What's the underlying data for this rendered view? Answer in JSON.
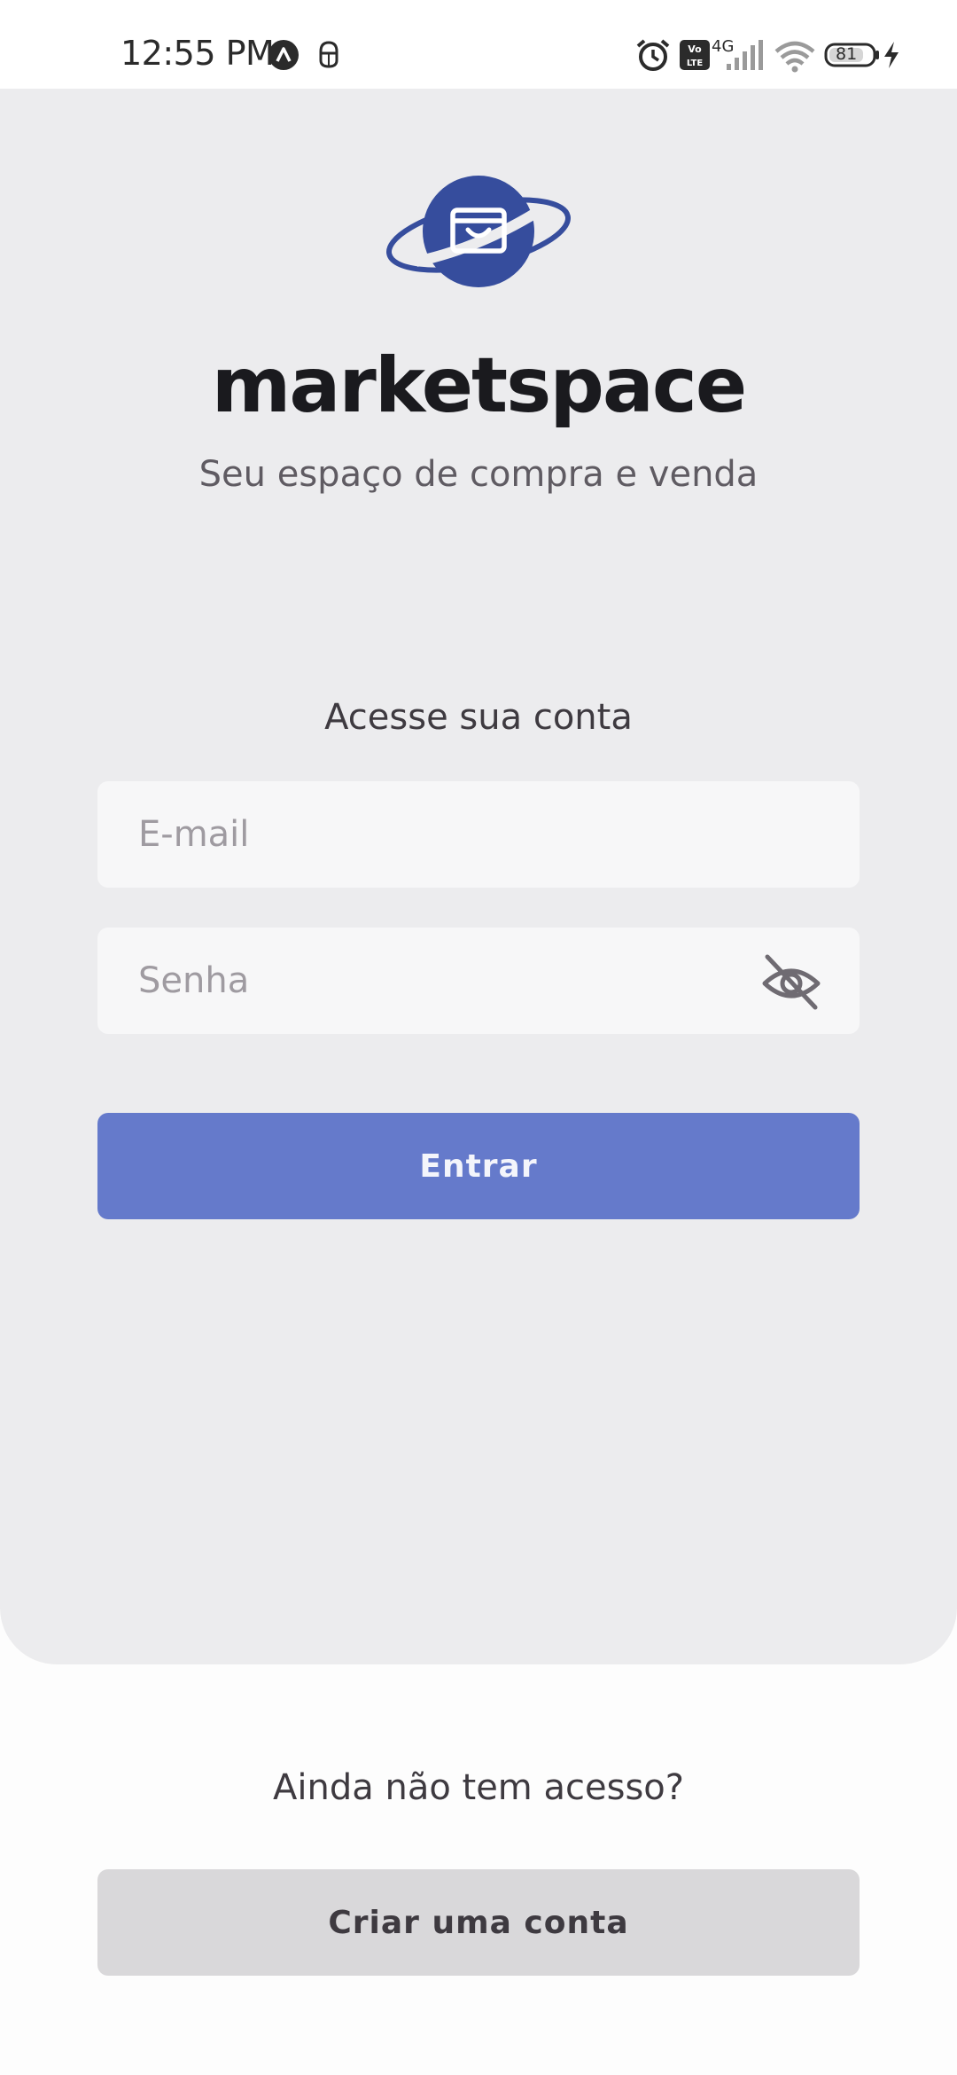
{
  "status_bar": {
    "time": "12:55 PM",
    "network": "4G",
    "volte": "Vo LTE",
    "battery_level": "81",
    "icons": [
      "app-notification-icon",
      "android-debug-icon",
      "alarm-icon",
      "volte-icon",
      "signal-icon",
      "wifi-icon",
      "battery-icon",
      "charging-icon"
    ]
  },
  "brand": {
    "name": "marketspace",
    "tagline": "Seu espaço de compra e venda",
    "accent_color": "#364D9D",
    "logo_icon": "shopping-bag-planet-icon"
  },
  "login": {
    "heading": "Acesse sua conta",
    "email_placeholder": "E-mail",
    "email_value": "",
    "password_placeholder": "Senha",
    "password_value": "",
    "password_toggle_icon": "eye-off-icon",
    "submit_label": "Entrar",
    "submit_color": "#647AC7"
  },
  "signup": {
    "prompt": "Ainda não tem acesso?",
    "button_label": "Criar uma conta"
  }
}
